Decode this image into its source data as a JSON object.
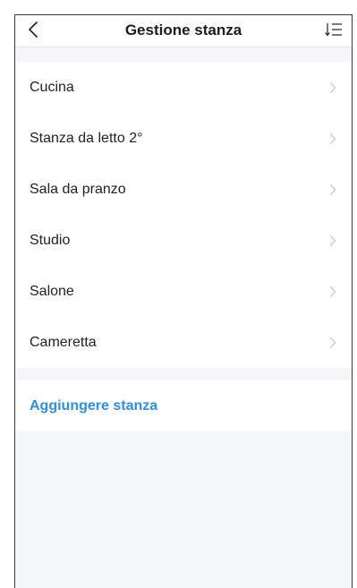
{
  "header": {
    "title": "Gestione stanza",
    "back_icon": "chevron-left-icon",
    "sort_icon": "sort-list-icon"
  },
  "rooms": [
    {
      "label": "Cucina"
    },
    {
      "label": "Stanza da letto 2°"
    },
    {
      "label": "Sala da pranzo"
    },
    {
      "label": "Studio"
    },
    {
      "label": "Salone"
    },
    {
      "label": "Cameretta"
    }
  ],
  "add_room": {
    "label": "Aggiungere stanza"
  },
  "colors": {
    "accent": "#2f8ee8",
    "background": "#f4f6f9",
    "chevron": "#c4c7cc"
  }
}
